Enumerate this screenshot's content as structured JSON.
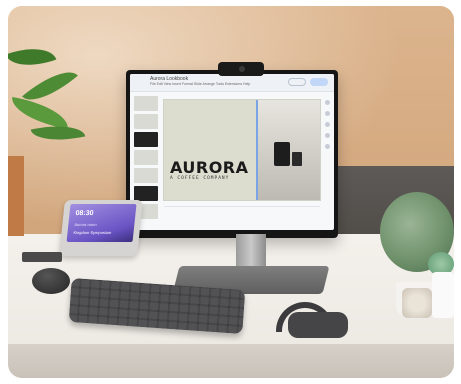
{
  "scene": {
    "monitor": {
      "doc_title": "Aurora Lookbook",
      "menu_text": "File Edit View Insert Format Slide Arrange Tools Extensions Help",
      "slide": {
        "brand": "AURORA",
        "subtitle": "A COFFEE COMPANY"
      }
    },
    "tablet": {
      "time": "08:30",
      "subtitle": "Aurora room",
      "row": "Kingdom Symposium"
    }
  },
  "colors": {
    "wall": "#d0a47a",
    "desk": "#f0ede8",
    "accent_purple": "#6a54c5",
    "plant_green": "#3f7a2b"
  }
}
